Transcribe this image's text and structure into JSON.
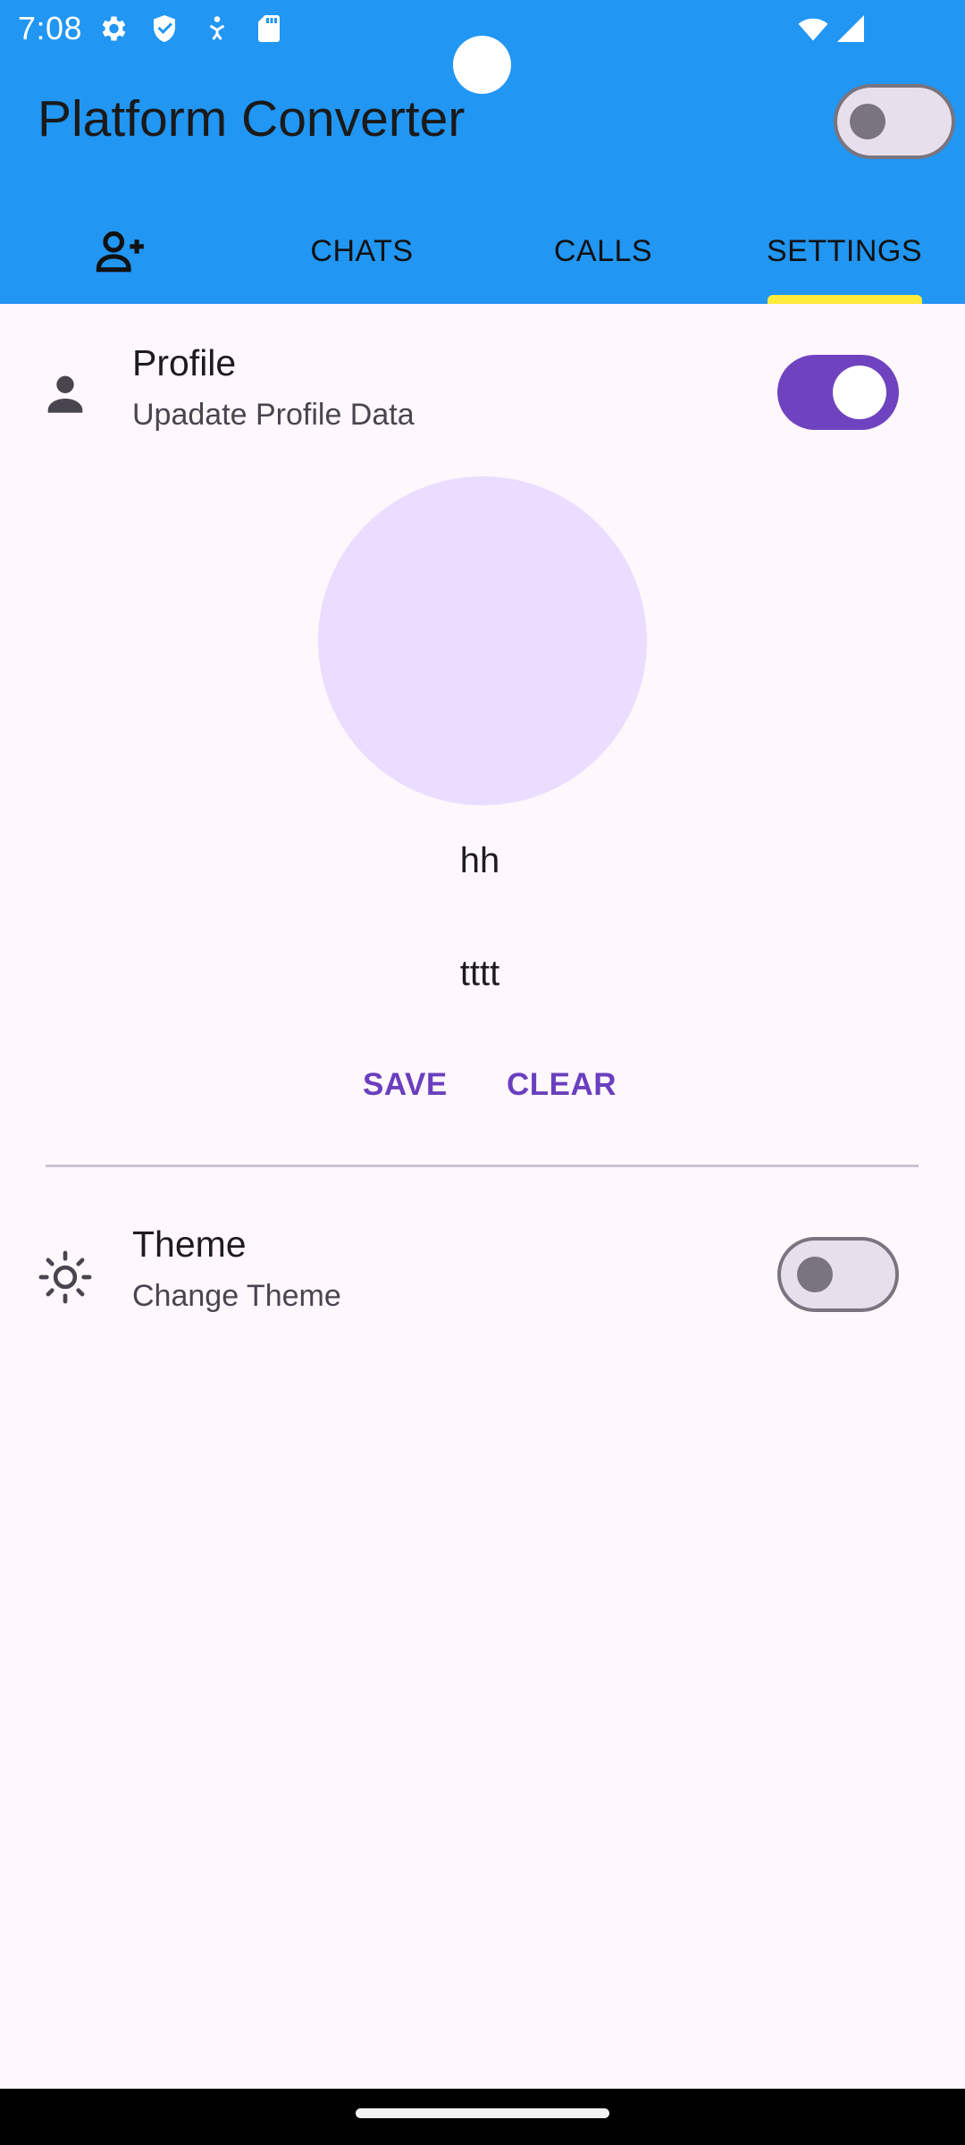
{
  "status_bar": {
    "time": "7:08",
    "left_icons": [
      "gear-icon",
      "shield-icon",
      "accessibility-icon",
      "sd-card-icon"
    ],
    "right_icons": [
      "wifi-icon",
      "signal-icon"
    ]
  },
  "app_bar": {
    "title": "Platform Converter",
    "switch_on": false
  },
  "tabs": [
    {
      "icon": "person-add-icon",
      "label": ""
    },
    {
      "label": "CHATS"
    },
    {
      "label": "CALLS"
    },
    {
      "label": "SETTINGS",
      "selected": true
    }
  ],
  "profile_tile": {
    "icon": "person-icon",
    "title": "Profile",
    "subtitle": "Upadate Profile Data",
    "switch_on": true
  },
  "profile": {
    "name": "hh",
    "about": "tttt",
    "save_label": "SAVE",
    "clear_label": "CLEAR"
  },
  "theme_tile": {
    "icon": "sun-icon",
    "title": "Theme",
    "subtitle": "Change Theme",
    "switch_on": false
  },
  "colors": {
    "app_bar": "#2196F3",
    "tab_indicator": "#FFEB3B",
    "accent": "#6F43C0",
    "background": "#FEF7FC",
    "avatar": "#EADDFF"
  }
}
